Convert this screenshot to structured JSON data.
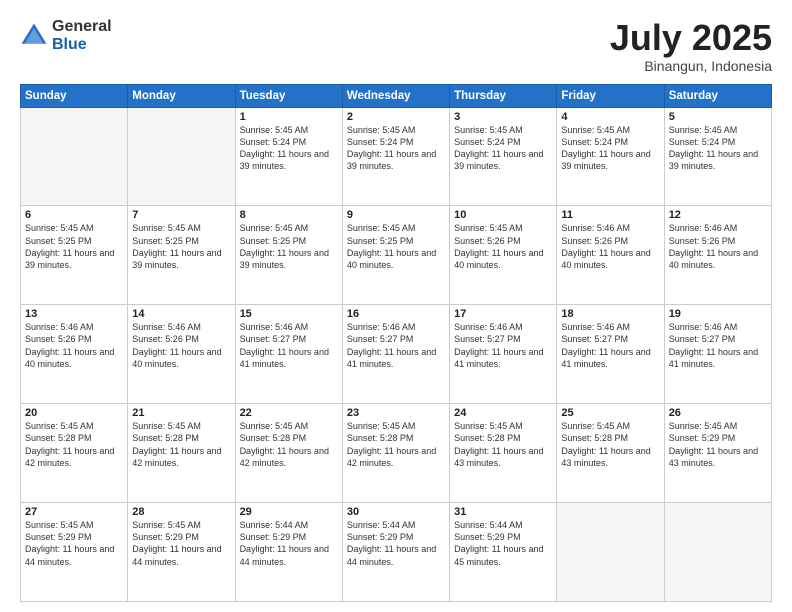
{
  "logo": {
    "general": "General",
    "blue": "Blue"
  },
  "header": {
    "title": "July 2025",
    "subtitle": "Binangun, Indonesia"
  },
  "weekdays": [
    "Sunday",
    "Monday",
    "Tuesday",
    "Wednesday",
    "Thursday",
    "Friday",
    "Saturday"
  ],
  "weeks": [
    [
      {
        "day": "",
        "info": ""
      },
      {
        "day": "",
        "info": ""
      },
      {
        "day": "1",
        "info": "Sunrise: 5:45 AM\nSunset: 5:24 PM\nDaylight: 11 hours and 39 minutes."
      },
      {
        "day": "2",
        "info": "Sunrise: 5:45 AM\nSunset: 5:24 PM\nDaylight: 11 hours and 39 minutes."
      },
      {
        "day": "3",
        "info": "Sunrise: 5:45 AM\nSunset: 5:24 PM\nDaylight: 11 hours and 39 minutes."
      },
      {
        "day": "4",
        "info": "Sunrise: 5:45 AM\nSunset: 5:24 PM\nDaylight: 11 hours and 39 minutes."
      },
      {
        "day": "5",
        "info": "Sunrise: 5:45 AM\nSunset: 5:24 PM\nDaylight: 11 hours and 39 minutes."
      }
    ],
    [
      {
        "day": "6",
        "info": "Sunrise: 5:45 AM\nSunset: 5:25 PM\nDaylight: 11 hours and 39 minutes."
      },
      {
        "day": "7",
        "info": "Sunrise: 5:45 AM\nSunset: 5:25 PM\nDaylight: 11 hours and 39 minutes."
      },
      {
        "day": "8",
        "info": "Sunrise: 5:45 AM\nSunset: 5:25 PM\nDaylight: 11 hours and 39 minutes."
      },
      {
        "day": "9",
        "info": "Sunrise: 5:45 AM\nSunset: 5:25 PM\nDaylight: 11 hours and 40 minutes."
      },
      {
        "day": "10",
        "info": "Sunrise: 5:45 AM\nSunset: 5:26 PM\nDaylight: 11 hours and 40 minutes."
      },
      {
        "day": "11",
        "info": "Sunrise: 5:46 AM\nSunset: 5:26 PM\nDaylight: 11 hours and 40 minutes."
      },
      {
        "day": "12",
        "info": "Sunrise: 5:46 AM\nSunset: 5:26 PM\nDaylight: 11 hours and 40 minutes."
      }
    ],
    [
      {
        "day": "13",
        "info": "Sunrise: 5:46 AM\nSunset: 5:26 PM\nDaylight: 11 hours and 40 minutes."
      },
      {
        "day": "14",
        "info": "Sunrise: 5:46 AM\nSunset: 5:26 PM\nDaylight: 11 hours and 40 minutes."
      },
      {
        "day": "15",
        "info": "Sunrise: 5:46 AM\nSunset: 5:27 PM\nDaylight: 11 hours and 41 minutes."
      },
      {
        "day": "16",
        "info": "Sunrise: 5:46 AM\nSunset: 5:27 PM\nDaylight: 11 hours and 41 minutes."
      },
      {
        "day": "17",
        "info": "Sunrise: 5:46 AM\nSunset: 5:27 PM\nDaylight: 11 hours and 41 minutes."
      },
      {
        "day": "18",
        "info": "Sunrise: 5:46 AM\nSunset: 5:27 PM\nDaylight: 11 hours and 41 minutes."
      },
      {
        "day": "19",
        "info": "Sunrise: 5:46 AM\nSunset: 5:27 PM\nDaylight: 11 hours and 41 minutes."
      }
    ],
    [
      {
        "day": "20",
        "info": "Sunrise: 5:45 AM\nSunset: 5:28 PM\nDaylight: 11 hours and 42 minutes."
      },
      {
        "day": "21",
        "info": "Sunrise: 5:45 AM\nSunset: 5:28 PM\nDaylight: 11 hours and 42 minutes."
      },
      {
        "day": "22",
        "info": "Sunrise: 5:45 AM\nSunset: 5:28 PM\nDaylight: 11 hours and 42 minutes."
      },
      {
        "day": "23",
        "info": "Sunrise: 5:45 AM\nSunset: 5:28 PM\nDaylight: 11 hours and 42 minutes."
      },
      {
        "day": "24",
        "info": "Sunrise: 5:45 AM\nSunset: 5:28 PM\nDaylight: 11 hours and 43 minutes."
      },
      {
        "day": "25",
        "info": "Sunrise: 5:45 AM\nSunset: 5:28 PM\nDaylight: 11 hours and 43 minutes."
      },
      {
        "day": "26",
        "info": "Sunrise: 5:45 AM\nSunset: 5:29 PM\nDaylight: 11 hours and 43 minutes."
      }
    ],
    [
      {
        "day": "27",
        "info": "Sunrise: 5:45 AM\nSunset: 5:29 PM\nDaylight: 11 hours and 44 minutes."
      },
      {
        "day": "28",
        "info": "Sunrise: 5:45 AM\nSunset: 5:29 PM\nDaylight: 11 hours and 44 minutes."
      },
      {
        "day": "29",
        "info": "Sunrise: 5:44 AM\nSunset: 5:29 PM\nDaylight: 11 hours and 44 minutes."
      },
      {
        "day": "30",
        "info": "Sunrise: 5:44 AM\nSunset: 5:29 PM\nDaylight: 11 hours and 44 minutes."
      },
      {
        "day": "31",
        "info": "Sunrise: 5:44 AM\nSunset: 5:29 PM\nDaylight: 11 hours and 45 minutes."
      },
      {
        "day": "",
        "info": ""
      },
      {
        "day": "",
        "info": ""
      }
    ]
  ]
}
